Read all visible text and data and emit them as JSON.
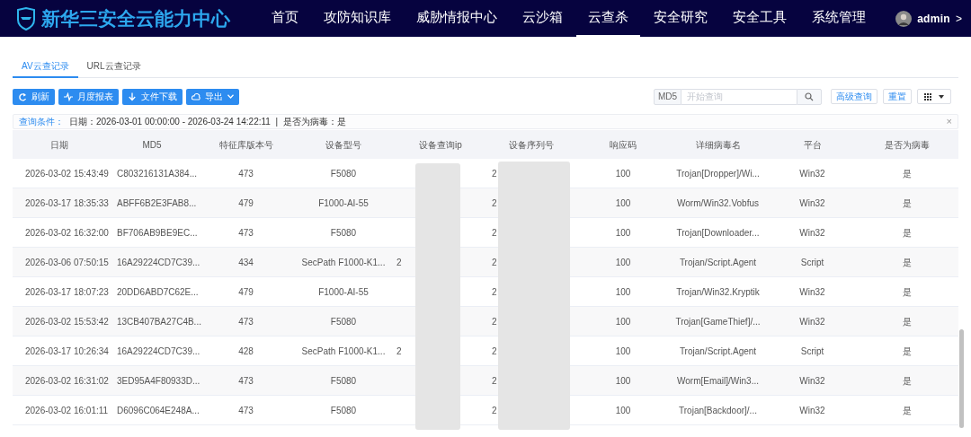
{
  "header": {
    "title": "新华三安全云能力中心",
    "nav": [
      {
        "label": "首页",
        "selected": false
      },
      {
        "label": "攻防知识库",
        "selected": false
      },
      {
        "label": "威胁情报中心",
        "selected": false
      },
      {
        "label": "云沙箱",
        "selected": false
      },
      {
        "label": "云查杀",
        "selected": true
      },
      {
        "label": "安全研究",
        "selected": false
      },
      {
        "label": "安全工具",
        "selected": false
      },
      {
        "label": "系统管理",
        "selected": false
      }
    ],
    "user": "admin",
    "user_caret": ">"
  },
  "tabs": [
    {
      "label": "AV云查记录",
      "selected": true
    },
    {
      "label": "URL云查记录",
      "selected": false
    }
  ],
  "toolbar": {
    "buttons": [
      {
        "label": "刷新",
        "dropdown": false
      },
      {
        "label": "月度报表",
        "dropdown": false
      },
      {
        "label": "文件下载",
        "dropdown": false
      },
      {
        "label": "导出",
        "dropdown": true
      }
    ],
    "search_prefix": "MD5",
    "search_placeholder": "开始查询",
    "advanced": "高级查询",
    "reset": "重置"
  },
  "query": {
    "label": "查询条件：",
    "text": "日期：2026-03-01 00:00:00 - 2026-03-24 14:22:11  |  是否为病毒：是",
    "close": "×"
  },
  "table": {
    "columns": [
      "日期",
      "MD5",
      "特征库版本号",
      "设备型号",
      "设备查询ip",
      "设备序列号",
      "响应码",
      "详细病毒名",
      "平台",
      "是否为病毒"
    ],
    "rows": [
      {
        "date": "2026-03-02 15:43:49",
        "md5": "C803216131A384...",
        "version": "473",
        "model": "F5080",
        "serial": "2",
        "code": "100",
        "virus": "Trojan[Dropper]/Wi...",
        "platform": "Win32",
        "is_virus": "是"
      },
      {
        "date": "2026-03-17 18:35:33",
        "md5": "ABFF6B2E3FAB8...",
        "version": "479",
        "model": "F1000-AI-55",
        "serial": "2",
        "code": "100",
        "virus": "Worm/Win32.Vobfus",
        "platform": "Win32",
        "is_virus": "是"
      },
      {
        "date": "2026-03-02 16:32:00",
        "md5": "BF706AB9BE9EC...",
        "version": "473",
        "model": "F5080",
        "serial": "2",
        "code": "100",
        "virus": "Trojan[Downloader...",
        "platform": "Win32",
        "is_virus": "是"
      },
      {
        "date": "2026-03-06 07:50:15",
        "md5": "16A29224CD7C39...",
        "version": "434",
        "model": "SecPath F1000-K1...",
        "ip": "2",
        "serial": "2",
        "code": "100",
        "virus": "Trojan/Script.Agent",
        "platform": "Script",
        "is_virus": "是"
      },
      {
        "date": "2026-03-17 18:07:23",
        "md5": "20DD6ABD7C62E...",
        "version": "479",
        "model": "F1000-AI-55",
        "serial": "2",
        "code": "100",
        "virus": "Trojan/Win32.Kryptik",
        "platform": "Win32",
        "is_virus": "是"
      },
      {
        "date": "2026-03-02 15:53:42",
        "md5": "13CB407BA27C4B...",
        "version": "473",
        "model": "F5080",
        "serial": "2",
        "code": "100",
        "virus": "Trojan[GameThief]/...",
        "platform": "Win32",
        "is_virus": "是"
      },
      {
        "date": "2026-03-17 10:26:34",
        "md5": "16A29224CD7C39...",
        "version": "428",
        "model": "SecPath F1000-K1...",
        "ip": "2",
        "serial": "2",
        "code": "100",
        "virus": "Trojan/Script.Agent",
        "platform": "Script",
        "is_virus": "是"
      },
      {
        "date": "2026-03-02 16:31:02",
        "md5": "3ED95A4F80933D...",
        "version": "473",
        "model": "F5080",
        "serial": "2",
        "code": "100",
        "virus": "Worm[Email]/Win3...",
        "platform": "Win32",
        "is_virus": "是"
      },
      {
        "date": "2026-03-02 16:01:11",
        "md5": "D6096C064E248A...",
        "version": "473",
        "model": "F5080",
        "serial": "2",
        "code": "100",
        "virus": "Trojan[Backdoor]/...",
        "platform": "Win32",
        "is_virus": "是"
      }
    ]
  }
}
